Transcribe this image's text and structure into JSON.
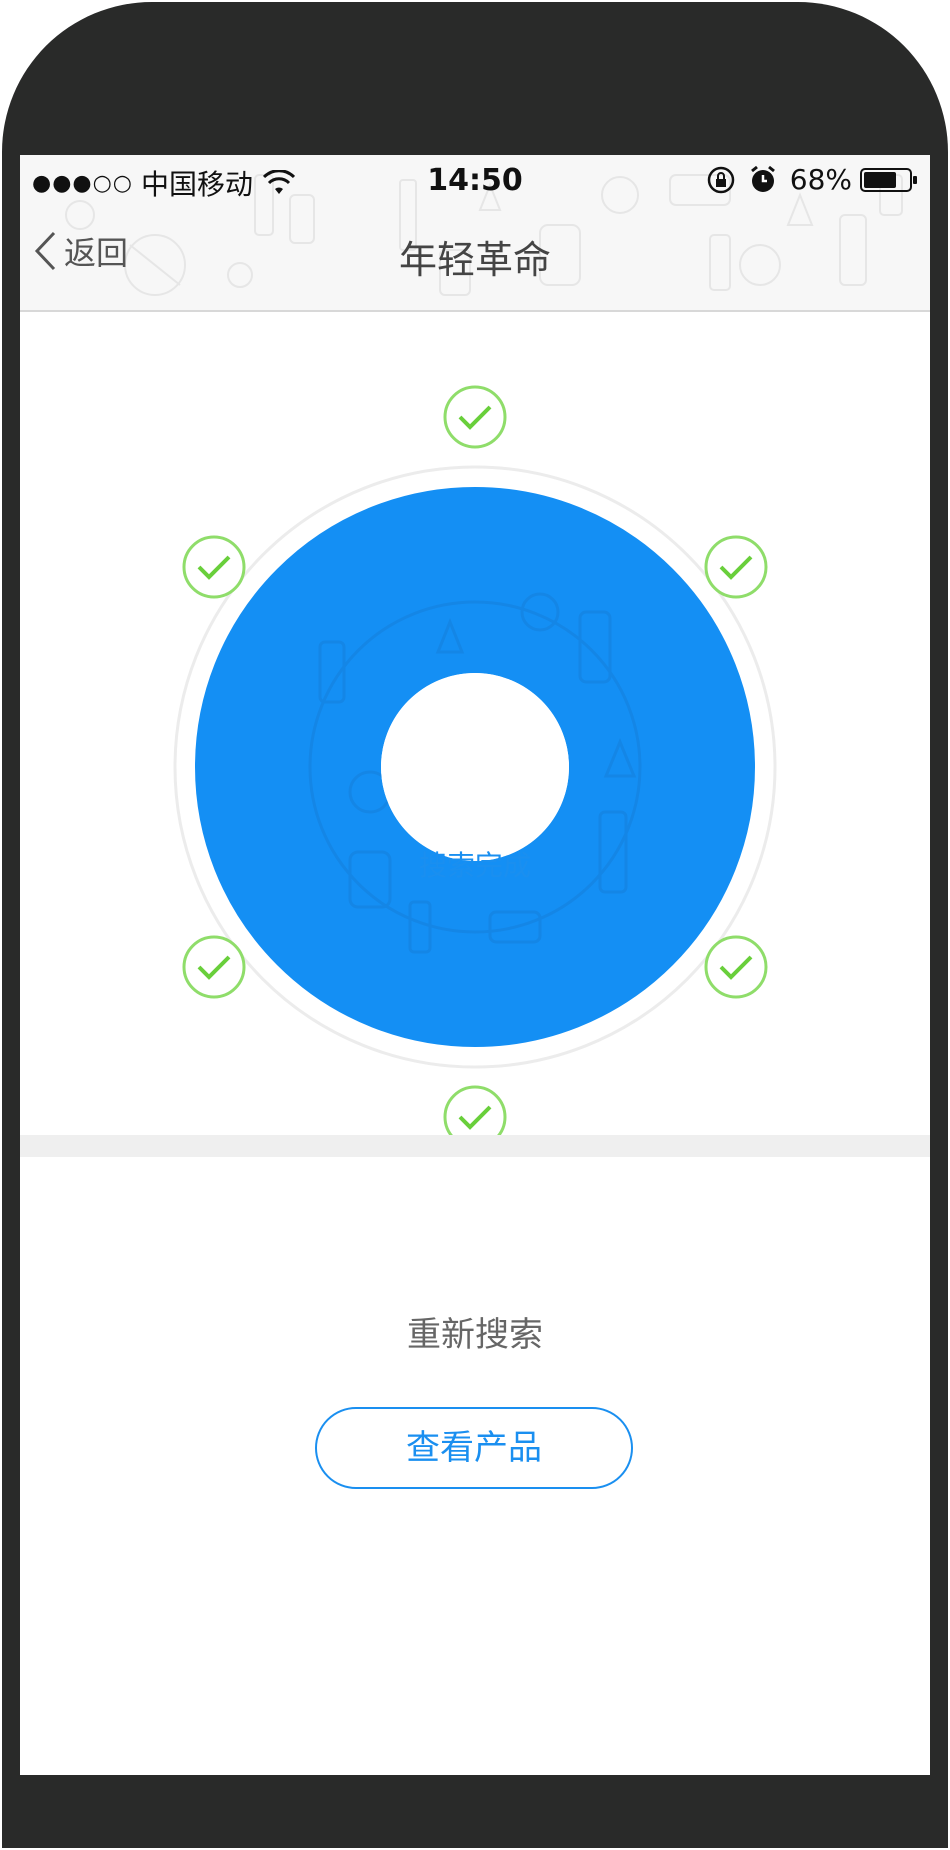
{
  "status_bar": {
    "signal": "●●●○○",
    "carrier": "中国移动",
    "time": "14:50",
    "battery_percent": "68%",
    "icons": [
      "wifi-icon",
      "rotation-lock-icon",
      "alarm-icon",
      "battery-icon"
    ]
  },
  "nav": {
    "back_label": "返回",
    "title": "年轻革命"
  },
  "result": {
    "center_label": "搜索完成",
    "completed_markers": 6,
    "accent_color": "#1a8ff0",
    "check_color": "#7ed957"
  },
  "actions": {
    "search_again_label": "重新搜索",
    "view_products_label": "查看产品"
  }
}
